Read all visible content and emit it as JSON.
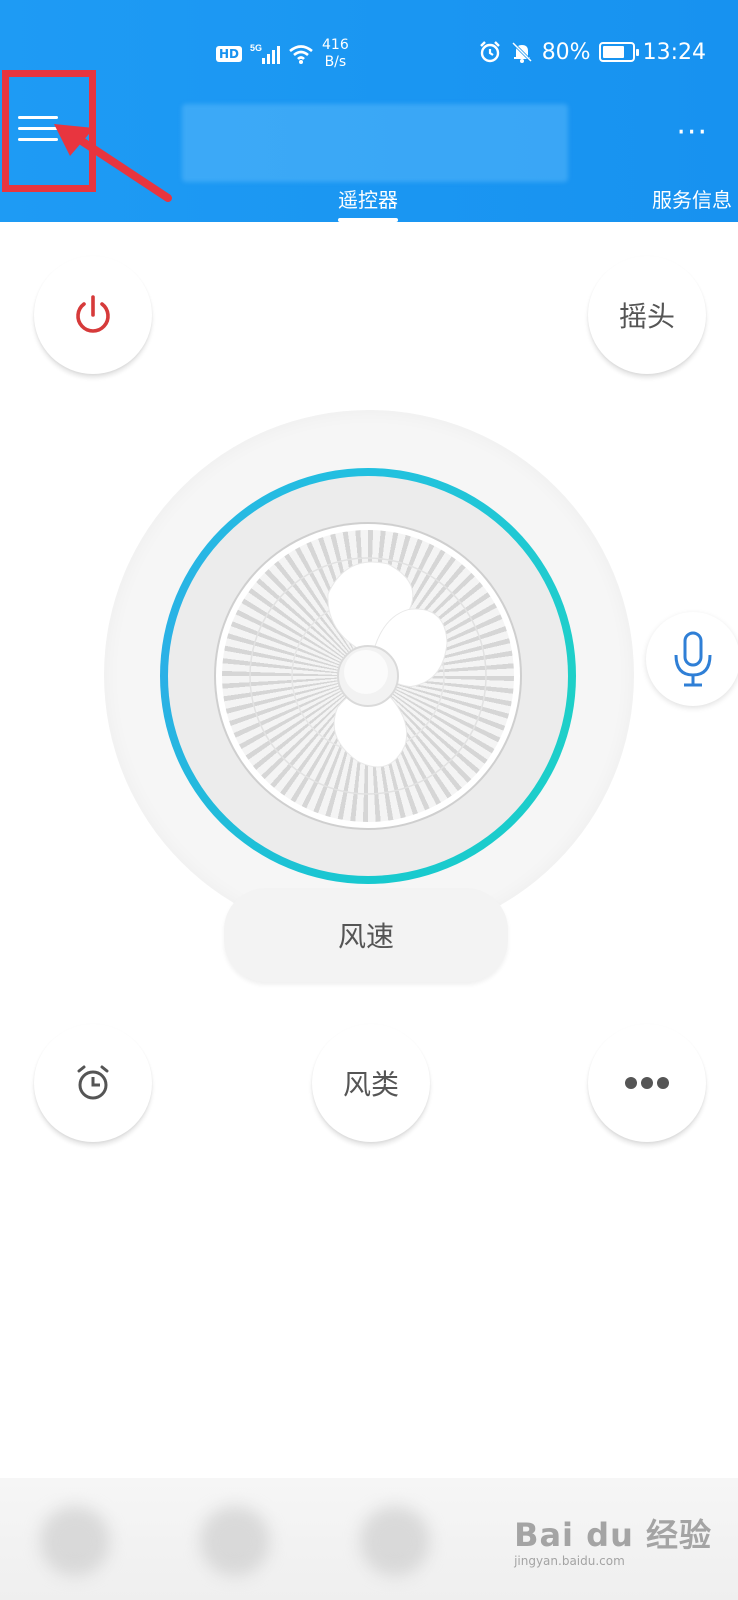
{
  "status_bar": {
    "hd": "HD",
    "network": "5G",
    "net_speed_value": "416",
    "net_speed_unit": "B/s",
    "battery": "80%",
    "battery_level": 0.8,
    "time": "13:24",
    "icons": [
      "wifi-icon",
      "alarm-icon",
      "mute-bell-icon",
      "battery-icon"
    ]
  },
  "header": {
    "tabs": [
      {
        "label": "遥控器",
        "active": true
      },
      {
        "label": "服务信息",
        "active": false
      }
    ],
    "more_icon": "···"
  },
  "controls": {
    "power_icon": "power-icon",
    "swing_label": "摇头",
    "speed_label": "风速",
    "mode_label": "风类",
    "timer_icon": "alarm-clock-icon",
    "more_icon": "more-dots-icon",
    "voice_icon": "microphone-icon"
  },
  "colors": {
    "header_blue": "#1792f0",
    "power_red": "#d63a3a",
    "ring_teal": "#1fd0c8",
    "annotation_red": "#e8353f"
  },
  "watermark": {
    "main": "Bai du 经验",
    "sub": "jingyan.baidu.com"
  }
}
